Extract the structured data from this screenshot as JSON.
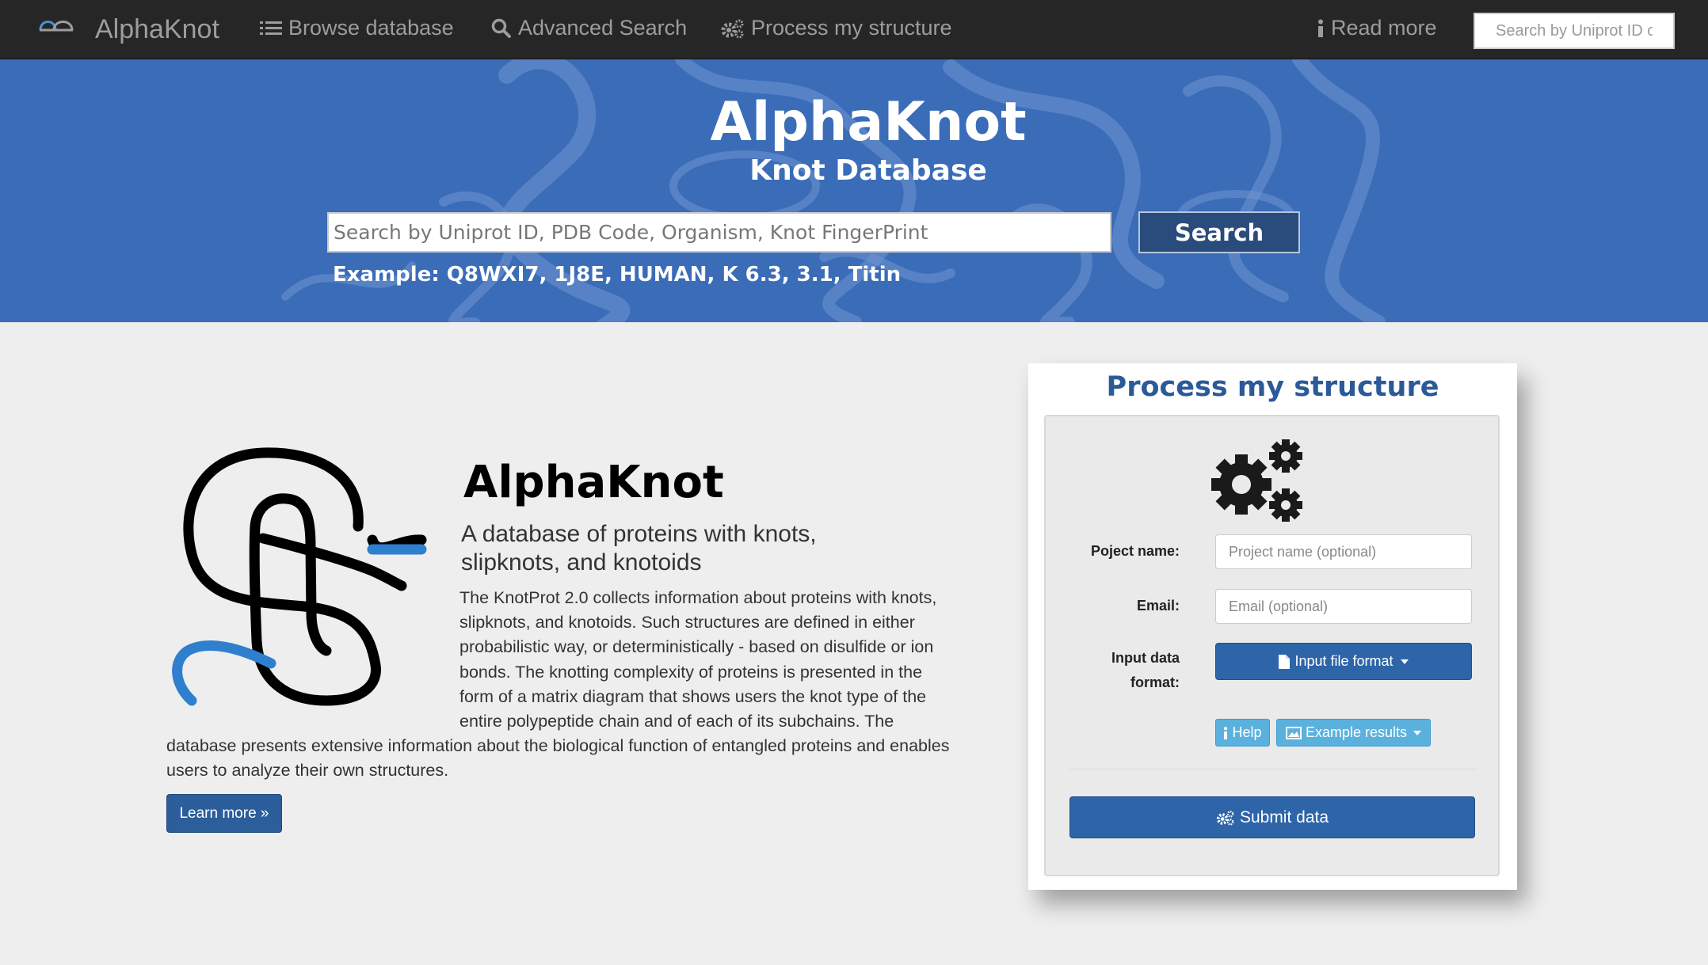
{
  "navbar": {
    "brand": "AlphaKnot",
    "items": [
      {
        "label": "Browse database",
        "icon": "list-icon"
      },
      {
        "label": "Advanced Search",
        "icon": "search-icon"
      },
      {
        "label": "Process my structure",
        "icon": "cogs-icon"
      }
    ],
    "read_more": {
      "label": "Read more",
      "icon": "info-icon"
    },
    "search_placeholder": "Search by Uniprot ID or..."
  },
  "hero": {
    "title": "AlphaKnot",
    "subtitle": "Knot Database",
    "search_placeholder": "Search by Uniprot ID, PDB Code, Organism, Knot FingerPrint",
    "search_button": "Search",
    "example": "Example: Q8WXI7, 1J8E, HUMAN, K 6.3, 3.1, Titin"
  },
  "intro": {
    "title": "AlphaKnot",
    "lead": "A database of proteins with knots, slipknots, and knotoids",
    "body": "The KnotProt 2.0 collects information about proteins with knots, slipknots, and knotoids. Such structures are defined in either probabilistic way, or deterministically - based on disulfide or ion bonds. The knotting complexity of proteins is presented in the form of a matrix diagram that shows users the knot type of the entire polypeptide chain and of each of its subchains. The database presents extensive information about the biological function of entangled proteins and enables users to analyze their own structures.",
    "learn_more": "Learn more »"
  },
  "process": {
    "title": "Process my structure",
    "project_label": "Poject name:",
    "project_placeholder": "Project name (optional)",
    "email_label": "Email:",
    "email_placeholder": "Email (optional)",
    "format_label_line1": "Input data",
    "format_label_line2": "format:",
    "format_button": "Input file format",
    "help_button": "Help",
    "example_button": "Example results",
    "submit_button": "Submit data"
  },
  "colors": {
    "navbar": "#262626",
    "hero": "#3a6cb8",
    "accent": "#2d65a8",
    "info": "#5bb1de",
    "panel_title": "#2c5a99"
  }
}
